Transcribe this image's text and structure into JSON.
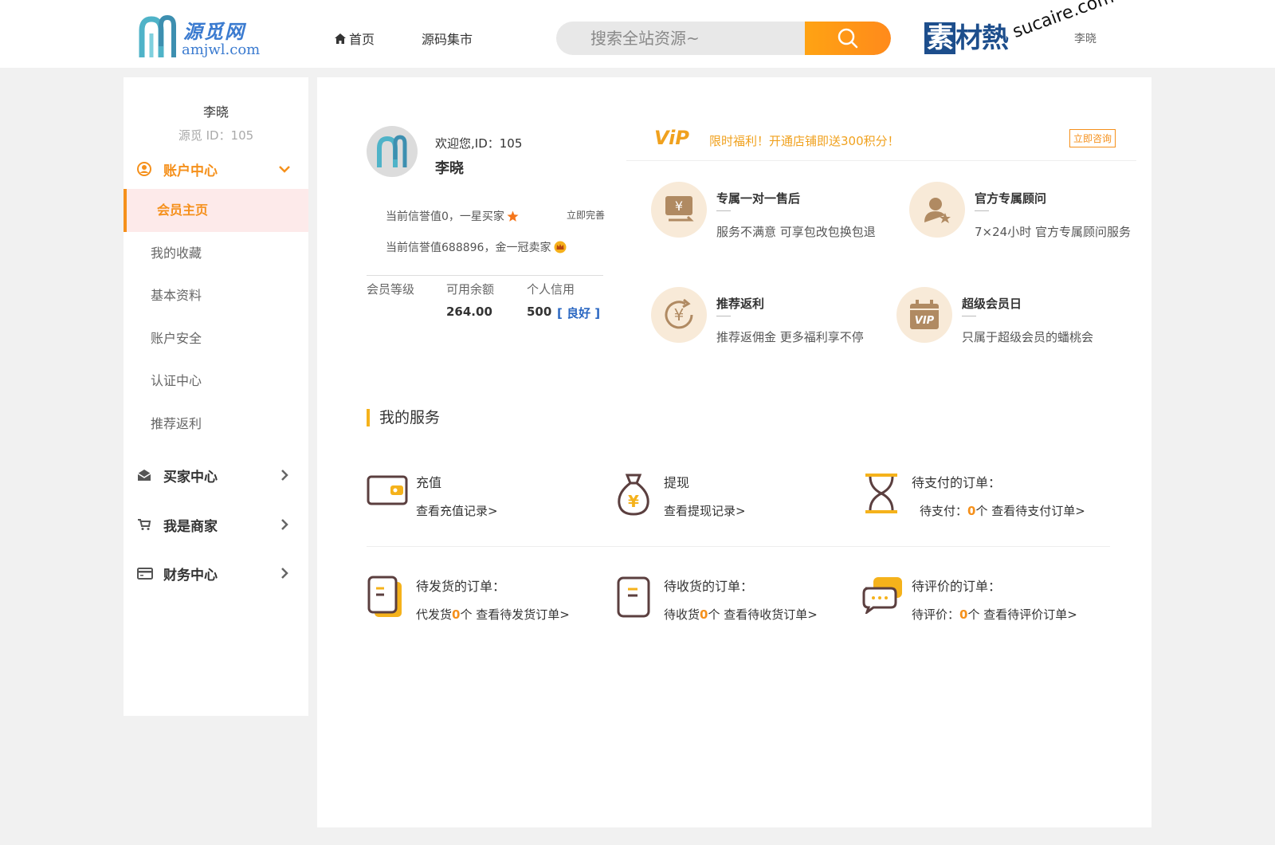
{
  "header": {
    "logo_cn": "源觅网",
    "logo_en": "amjwl.com",
    "nav": [
      {
        "label": "首页",
        "icon": "home-icon"
      },
      {
        "label": "源码集市"
      }
    ],
    "search": {
      "placeholder": "搜索全站资源~"
    },
    "watermark": {
      "cn_boxed": "素",
      "cn": "材熱",
      "en": "sucaire.com",
      "user": "李晓"
    }
  },
  "sidebar": {
    "user_name": "李晓",
    "user_id": "源觅 ID：105",
    "account_center": {
      "label": "账户中心",
      "items": [
        "会员主页",
        "我的收藏",
        "基本资料",
        "账户安全",
        "认证中心",
        "推荐返利"
      ]
    },
    "sections": [
      {
        "label": "买家中心",
        "icon": "mail-icon"
      },
      {
        "label": "我是商家",
        "icon": "cart-icon"
      },
      {
        "label": "财务中心",
        "icon": "credit-card-icon"
      }
    ]
  },
  "profile": {
    "welcome": "欢迎您,ID：105",
    "name": "李晓",
    "credit_buyer": "当前信誉值0，一星买家",
    "improve": "立即完善",
    "credit_seller": "当前信誉值688896，金一冠卖家",
    "stats": {
      "level_label": "会员等级",
      "balance_label": "可用余额",
      "credit_label": "个人信用",
      "balance": "264.00",
      "credit": "500",
      "credit_status": "[ 良好 ]"
    }
  },
  "vip": {
    "logo": "ViP",
    "text": "限时福利！开通店铺即送300积分！",
    "consult": "立即咨询"
  },
  "perks": [
    {
      "title": "专属一对一售后",
      "desc": "服务不满意 可享包改包换包退",
      "icon": "yen-card-icon"
    },
    {
      "title": "官方专属顾问",
      "desc": "7×24小时 官方专属顾问服务",
      "icon": "advisor-icon"
    },
    {
      "title": "推荐返利",
      "desc": "推荐返佣金 更多福利享不停",
      "icon": "yen-rebate-icon"
    },
    {
      "title": "超级会员日",
      "desc": "只属于超级会员的蟠桃会",
      "icon": "vip-calendar-icon"
    }
  ],
  "services": {
    "heading": "我的服务",
    "items": [
      {
        "title": "充值",
        "link_prefix": "",
        "count": "",
        "link_suffix": "查看充值记录>",
        "icon": "wallet-icon"
      },
      {
        "title": "提现",
        "link_prefix": "",
        "count": "",
        "link_suffix": "查看提现记录>",
        "icon": "money-bag-icon"
      },
      {
        "title": "待支付的订单：",
        "link_prefix": "待支付：",
        "count": "0",
        "link_suffix": "个 查看待支付订单>",
        "icon": "hourglass-icon"
      },
      {
        "title": "待发货的订单：",
        "link_prefix": "代发货",
        "count": "0",
        "link_suffix": "个 查看待发货订单>",
        "icon": "document-icon"
      },
      {
        "title": "待收货的订单：",
        "link_prefix": "待收货",
        "count": "0",
        "link_suffix": "个 查看待收货订单>",
        "icon": "receipt-icon"
      },
      {
        "title": "待评价的订单：",
        "link_prefix": "待评价：",
        "count": "0",
        "link_suffix": "个 查看待评价订单>",
        "icon": "chat-icon"
      }
    ]
  },
  "colors": {
    "accent": "#f5901b",
    "vip_gold": "#f0a11e",
    "link_blue": "#2a67c2",
    "brand_blue": "#3b7bd0"
  }
}
